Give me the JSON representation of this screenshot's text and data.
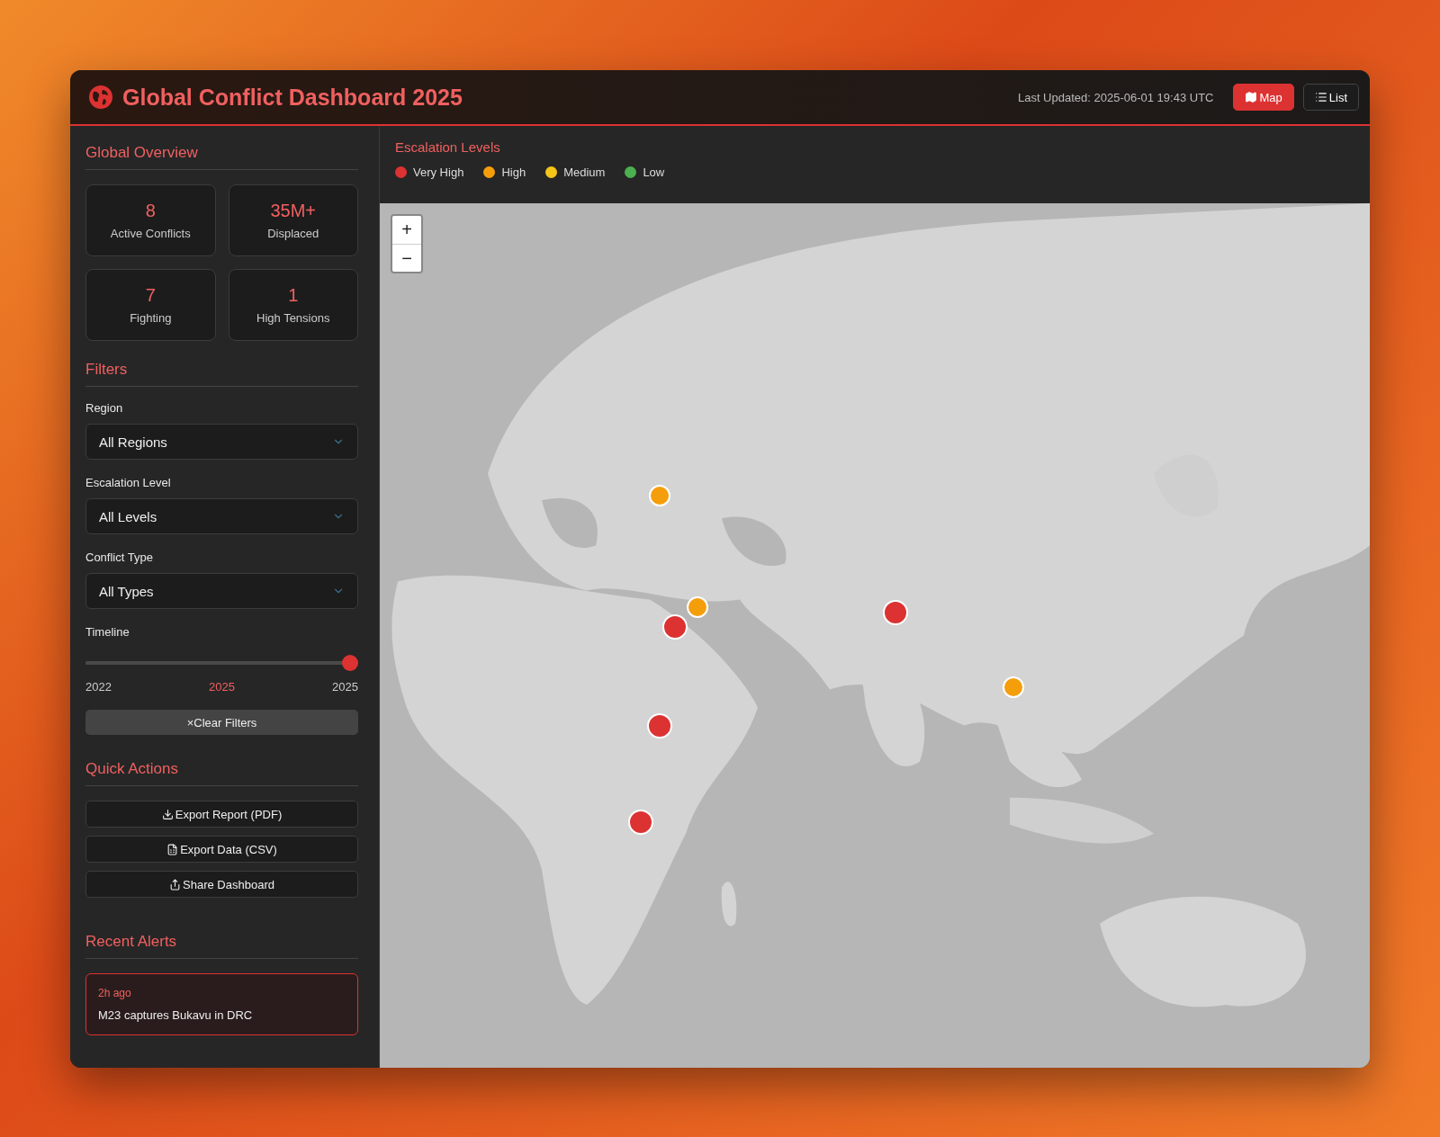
{
  "header": {
    "title": "Global Conflict Dashboard 2025",
    "last_updated": "Last Updated: 2025-06-01 19:43 UTC",
    "views": [
      {
        "label": "Map",
        "kind": "map",
        "selected": true
      },
      {
        "label": "List",
        "kind": "list",
        "selected": false
      }
    ]
  },
  "sidebar": {
    "overview": {
      "title": "Global Overview",
      "stats": [
        {
          "value": "8",
          "label": "Active Conflicts"
        },
        {
          "value": "35M+",
          "label": "Displaced"
        },
        {
          "value": "7",
          "label": "Fighting"
        },
        {
          "value": "1",
          "label": "High Tensions"
        }
      ]
    },
    "filters": {
      "title": "Filters",
      "selects": [
        {
          "label": "Region",
          "value": "All Regions"
        },
        {
          "label": "Escalation Level",
          "value": "All Levels"
        },
        {
          "label": "Conflict Type",
          "value": "All Types"
        }
      ],
      "timeline": {
        "label": "Timeline",
        "level": 1,
        "min": "2022",
        "current": "2025",
        "max": "2025"
      },
      "clear": "Clear Filters",
      "clear_icon": "×"
    },
    "quick_actions": {
      "title": "Quick Actions",
      "buttons": [
        {
          "label": "Export Report (PDF)",
          "kind": "download"
        },
        {
          "label": "Export Data (CSV)",
          "kind": "csv"
        },
        {
          "label": "Share Dashboard",
          "kind": "share"
        }
      ]
    },
    "alerts": {
      "title": "Recent Alerts",
      "items": [
        {
          "time": "2h ago",
          "text": "M23 captures Bukavu in DRC"
        }
      ]
    }
  },
  "map": {
    "legend_title": "Escalation Levels",
    "legend": [
      {
        "label": "Very High",
        "color": "#dc3232"
      },
      {
        "label": "High",
        "color": "#f59e0b"
      },
      {
        "label": "Medium",
        "color": "#f5c518"
      },
      {
        "label": "Low",
        "color": "#4caf50"
      }
    ],
    "zoom": [
      "+",
      "−"
    ],
    "markers": [
      {
        "color": "#f59e0b"
      },
      {
        "color": "#f59e0b"
      },
      {
        "color": "#dc3232"
      },
      {
        "color": "#dc3232"
      },
      {
        "color": "#f59e0b"
      },
      {
        "color": "#dc3232"
      },
      {
        "color": "#dc3232"
      }
    ]
  }
}
